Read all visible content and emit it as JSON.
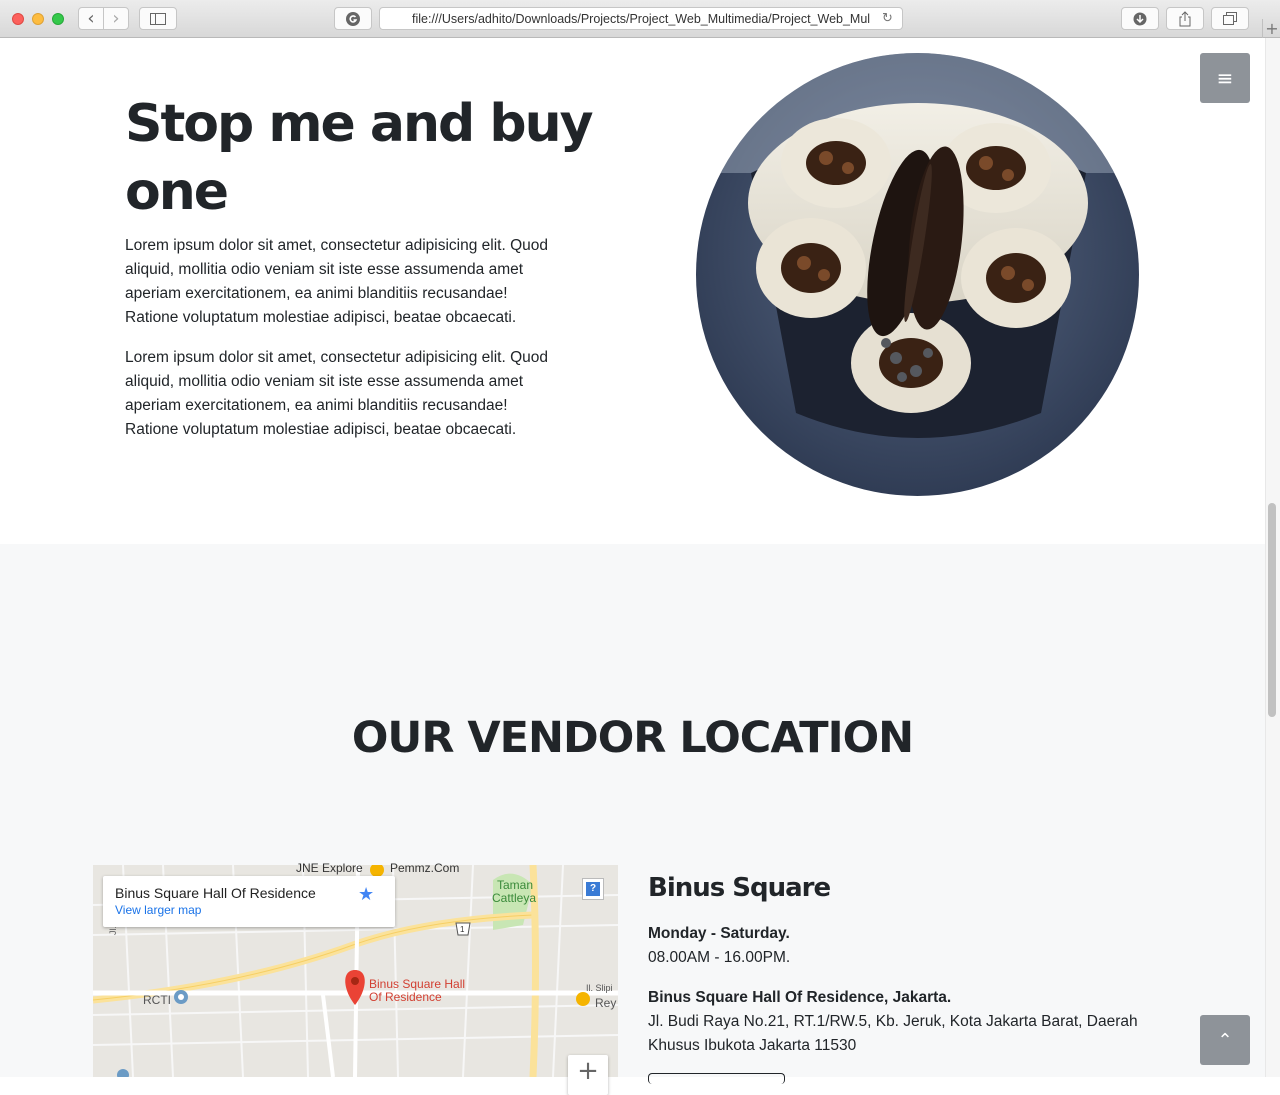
{
  "browser": {
    "url": "file:///Users/adhito/Downloads/Projects/Project_Web_Multimedia/Project_Web_Multimedia/index.html",
    "back_glyph": "‹",
    "forward_glyph": "›",
    "reload_glyph": "↻",
    "newtab_glyph": "+",
    "icons": [
      "back-icon",
      "forward-icon",
      "sidebar-icon",
      "grammarly-icon",
      "reload-icon",
      "download-icon",
      "share-icon",
      "tabs-icon",
      "new-tab-icon"
    ]
  },
  "hero": {
    "title": "Stop me and buy one",
    "paragraphs": [
      "Lorem ipsum dolor sit amet, consectetur adipisicing elit. Quod aliquid, mollitia odio veniam sit iste esse assumenda amet aperiam exercitationem, ea animi blanditiis recusandae! Ratione voluptatum molestiae adipisci, beatae obcaecati.",
      "Lorem ipsum dolor sit amet, consectetur adipisicing elit. Quod aliquid, mollitia odio veniam sit iste esse assumenda amet aperiam exercitationem, ea animi blanditiis recusandae! Ratione voluptatum molestiae adipisci, beatae obcaecati."
    ],
    "image_icon": "rolled-ice-cream-cup-photo"
  },
  "menu_button": {
    "glyph": "≡",
    "icon": "hamburger-menu-icon"
  },
  "vendor": {
    "title": "OUR VENDOR LOCATION",
    "map": {
      "place_title": "Binus Square Hall Of Residence",
      "view_larger": "View larger map",
      "star_glyph": "★",
      "help_glyph": "?",
      "zoom_in_glyph": "+",
      "pin_label_line1": "Binus Square Hall",
      "pin_label_line2": "Of Residence",
      "labels": {
        "jne": "JNE Explore",
        "pemmz": "Pemmz.Com",
        "taman1": "Taman",
        "taman2": "Cattleya",
        "rcti": "RCTI",
        "jl_kedo": "Jl. Kedo",
        "slipi": "Il. Slipi",
        "rey": "Rey",
        "route": "1"
      }
    },
    "location": {
      "name": "Binus Square",
      "days": "Monday - Saturday.",
      "hours": "08.00AM - 16.00PM.",
      "address_title": "Binus Square Hall Of Residence, Jakarta.",
      "address": "Jl. Budi Raya No.21, RT.1/RW.5, Kb. Jeruk, Kota Jakarta Barat, Daerah Khusus Ibukota Jakarta 11530"
    }
  },
  "scroll_top": {
    "glyph": "⌃",
    "icon": "chevron-up-icon"
  }
}
